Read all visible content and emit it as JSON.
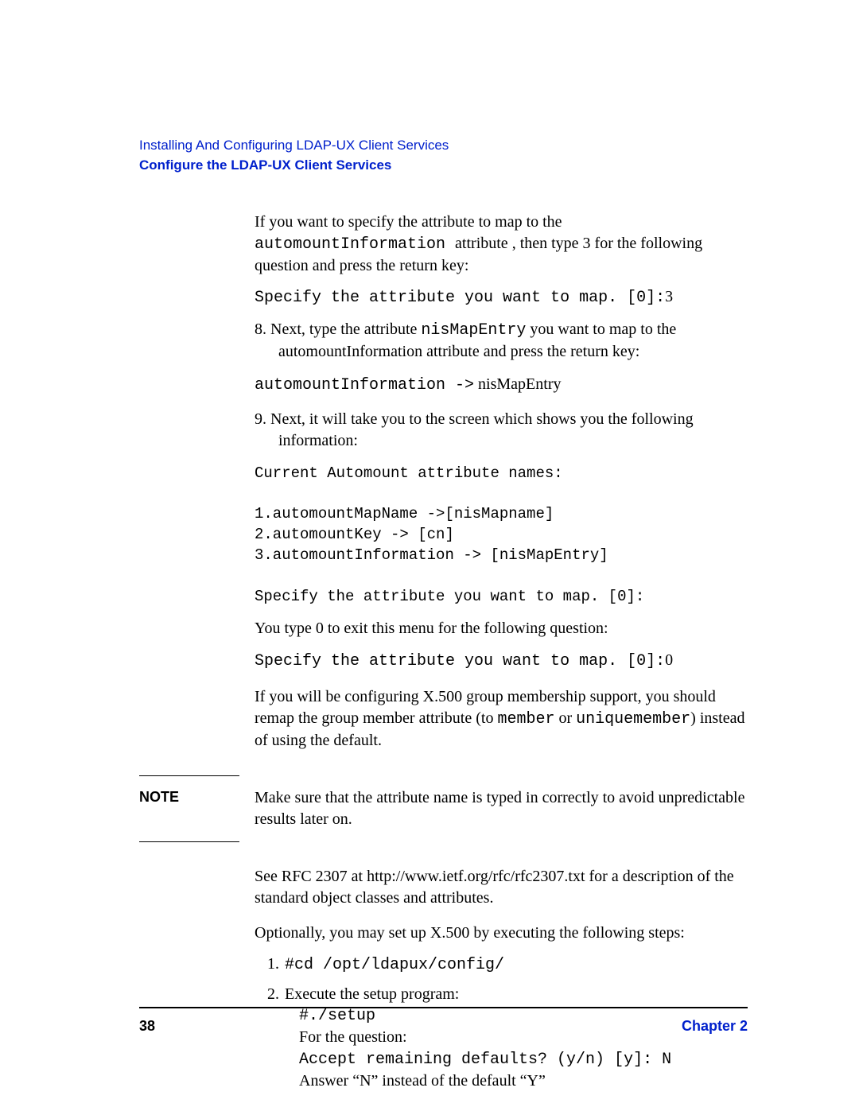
{
  "header": {
    "chapter_title": "Installing And Configuring LDAP-UX Client Services",
    "section_title": "Configure the LDAP-UX Client Services"
  },
  "body": {
    "intro_p1_a": "If you want to specify the attribute to map to the ",
    "intro_p1_mono": "automountInformation ",
    "intro_p1_b": " attribute , then type 3 for the following question and press the return key:",
    "intro_code1_a": "Specify the attribute you want to map. [0]:",
    "intro_code1_b": "3",
    "step8_num": "8.",
    "step8_a": " Next, type  the attribute  ",
    "step8_mono": "nisMapEntry",
    "step8_b": " you want to map to the automountInformation attribute and press the return key:",
    "step8_code_a": "automountInformation ->",
    "step8_code_b": " nisMapEntry",
    "step9_num": "9.",
    "step9_a": " Next, it will take you to the screen which shows you the following information:",
    "step9_code": "Current Automount attribute names:\n\n1.automountMapName ->[nisMapname]\n2.automountKey -> [cn]\n3.automountInformation -> [nisMapEntry]\n\nSpecify the attribute you want to map. [0]:",
    "step9_p2": " You type 0  to exit this menu for the following question:",
    "step9_code2_a": "Specify the attribute you want to map. [0]:",
    "step9_code2_b": "0",
    "x500_a": "If you will be configuring X.500 group membership support, you should remap the group member attribute (to ",
    "x500_mono1": "member",
    "x500_b": " or ",
    "x500_mono2": "uniquemember",
    "x500_c": ") instead of using the default.",
    "note_label": "NOTE",
    "note_text": "Make sure that the attribute name is typed in correctly to avoid unpredictable results later on.",
    "rfc_text": "See RFC 2307 at http://www.ietf.org/rfc/rfc2307.txt for a description of the standard object classes and attributes.",
    "opt_text": "Optionally, you may set up X.500 by executing the following steps:",
    "li1": "#cd /opt/ldapux/config/",
    "li2_a": "Execute the setup program:",
    "li2_code1": "#./setup",
    "li2_b": "For the question:",
    "li2_code2": "Accept remaining defaults? (y/n) [y]: N",
    "li2_c": "Answer “N” instead of the default “Y”"
  },
  "footer": {
    "page_number": "38",
    "chapter_label": "Chapter 2"
  }
}
